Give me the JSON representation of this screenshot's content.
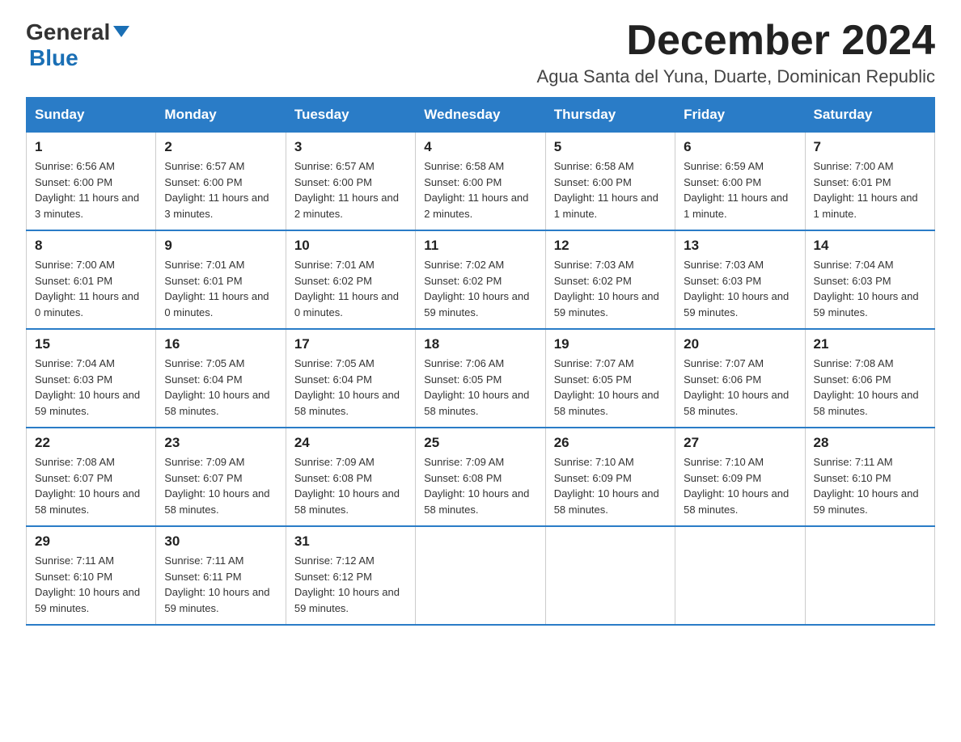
{
  "logo": {
    "general": "General",
    "blue": "Blue"
  },
  "title": "December 2024",
  "location": "Agua Santa del Yuna, Duarte, Dominican Republic",
  "weekdays": [
    "Sunday",
    "Monday",
    "Tuesday",
    "Wednesday",
    "Thursday",
    "Friday",
    "Saturday"
  ],
  "weeks": [
    [
      {
        "day": "1",
        "sunrise": "6:56 AM",
        "sunset": "6:00 PM",
        "daylight": "11 hours and 3 minutes."
      },
      {
        "day": "2",
        "sunrise": "6:57 AM",
        "sunset": "6:00 PM",
        "daylight": "11 hours and 3 minutes."
      },
      {
        "day": "3",
        "sunrise": "6:57 AM",
        "sunset": "6:00 PM",
        "daylight": "11 hours and 2 minutes."
      },
      {
        "day": "4",
        "sunrise": "6:58 AM",
        "sunset": "6:00 PM",
        "daylight": "11 hours and 2 minutes."
      },
      {
        "day": "5",
        "sunrise": "6:58 AM",
        "sunset": "6:00 PM",
        "daylight": "11 hours and 1 minute."
      },
      {
        "day": "6",
        "sunrise": "6:59 AM",
        "sunset": "6:00 PM",
        "daylight": "11 hours and 1 minute."
      },
      {
        "day": "7",
        "sunrise": "7:00 AM",
        "sunset": "6:01 PM",
        "daylight": "11 hours and 1 minute."
      }
    ],
    [
      {
        "day": "8",
        "sunrise": "7:00 AM",
        "sunset": "6:01 PM",
        "daylight": "11 hours and 0 minutes."
      },
      {
        "day": "9",
        "sunrise": "7:01 AM",
        "sunset": "6:01 PM",
        "daylight": "11 hours and 0 minutes."
      },
      {
        "day": "10",
        "sunrise": "7:01 AM",
        "sunset": "6:02 PM",
        "daylight": "11 hours and 0 minutes."
      },
      {
        "day": "11",
        "sunrise": "7:02 AM",
        "sunset": "6:02 PM",
        "daylight": "10 hours and 59 minutes."
      },
      {
        "day": "12",
        "sunrise": "7:03 AM",
        "sunset": "6:02 PM",
        "daylight": "10 hours and 59 minutes."
      },
      {
        "day": "13",
        "sunrise": "7:03 AM",
        "sunset": "6:03 PM",
        "daylight": "10 hours and 59 minutes."
      },
      {
        "day": "14",
        "sunrise": "7:04 AM",
        "sunset": "6:03 PM",
        "daylight": "10 hours and 59 minutes."
      }
    ],
    [
      {
        "day": "15",
        "sunrise": "7:04 AM",
        "sunset": "6:03 PM",
        "daylight": "10 hours and 59 minutes."
      },
      {
        "day": "16",
        "sunrise": "7:05 AM",
        "sunset": "6:04 PM",
        "daylight": "10 hours and 58 minutes."
      },
      {
        "day": "17",
        "sunrise": "7:05 AM",
        "sunset": "6:04 PM",
        "daylight": "10 hours and 58 minutes."
      },
      {
        "day": "18",
        "sunrise": "7:06 AM",
        "sunset": "6:05 PM",
        "daylight": "10 hours and 58 minutes."
      },
      {
        "day": "19",
        "sunrise": "7:07 AM",
        "sunset": "6:05 PM",
        "daylight": "10 hours and 58 minutes."
      },
      {
        "day": "20",
        "sunrise": "7:07 AM",
        "sunset": "6:06 PM",
        "daylight": "10 hours and 58 minutes."
      },
      {
        "day": "21",
        "sunrise": "7:08 AM",
        "sunset": "6:06 PM",
        "daylight": "10 hours and 58 minutes."
      }
    ],
    [
      {
        "day": "22",
        "sunrise": "7:08 AM",
        "sunset": "6:07 PM",
        "daylight": "10 hours and 58 minutes."
      },
      {
        "day": "23",
        "sunrise": "7:09 AM",
        "sunset": "6:07 PM",
        "daylight": "10 hours and 58 minutes."
      },
      {
        "day": "24",
        "sunrise": "7:09 AM",
        "sunset": "6:08 PM",
        "daylight": "10 hours and 58 minutes."
      },
      {
        "day": "25",
        "sunrise": "7:09 AM",
        "sunset": "6:08 PM",
        "daylight": "10 hours and 58 minutes."
      },
      {
        "day": "26",
        "sunrise": "7:10 AM",
        "sunset": "6:09 PM",
        "daylight": "10 hours and 58 minutes."
      },
      {
        "day": "27",
        "sunrise": "7:10 AM",
        "sunset": "6:09 PM",
        "daylight": "10 hours and 58 minutes."
      },
      {
        "day": "28",
        "sunrise": "7:11 AM",
        "sunset": "6:10 PM",
        "daylight": "10 hours and 59 minutes."
      }
    ],
    [
      {
        "day": "29",
        "sunrise": "7:11 AM",
        "sunset": "6:10 PM",
        "daylight": "10 hours and 59 minutes."
      },
      {
        "day": "30",
        "sunrise": "7:11 AM",
        "sunset": "6:11 PM",
        "daylight": "10 hours and 59 minutes."
      },
      {
        "day": "31",
        "sunrise": "7:12 AM",
        "sunset": "6:12 PM",
        "daylight": "10 hours and 59 minutes."
      },
      null,
      null,
      null,
      null
    ]
  ]
}
